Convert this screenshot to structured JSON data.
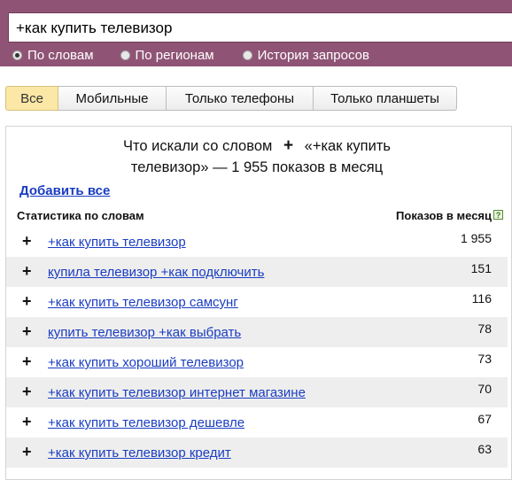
{
  "search": {
    "query": "+как купить телевизор"
  },
  "radios": [
    {
      "label": "По словам",
      "checked": true
    },
    {
      "label": "По регионам",
      "checked": false
    },
    {
      "label": "История запросов",
      "checked": false
    }
  ],
  "tabs": [
    "Все",
    "Мобильные",
    "Только телефоны",
    "Только планшеты"
  ],
  "summary": {
    "prefix": "Что искали со словом",
    "plus": "+",
    "query_line1": "«+как купить",
    "line2": "телевизор» — 1 955 показов в месяц"
  },
  "add_all_label": "Добавить все",
  "table": {
    "col_stat": "Статистика по словам",
    "col_count": "Показов в месяц",
    "help_glyph": "?",
    "plus_glyph": "+",
    "rows": [
      {
        "phrase": "+как купить телевизор",
        "count": "1 955"
      },
      {
        "phrase": "купила телевизор +как подключить",
        "count": "151"
      },
      {
        "phrase": "+как купить телевизор самсунг",
        "count": "116"
      },
      {
        "phrase": "купить телевизор +как выбрать",
        "count": "78"
      },
      {
        "phrase": "+как купить хороший телевизор",
        "count": "73"
      },
      {
        "phrase": "+как купить телевизор интернет магазине",
        "count": "70"
      },
      {
        "phrase": "+как купить телевизор дешевле",
        "count": "67"
      },
      {
        "phrase": "+как купить телевизор кредит",
        "count": "63"
      }
    ]
  },
  "colors": {
    "header": "#8f5475",
    "link": "#1a3dc1",
    "active_tab": "#fbe8a6",
    "alt_row": "#eeeeee"
  }
}
